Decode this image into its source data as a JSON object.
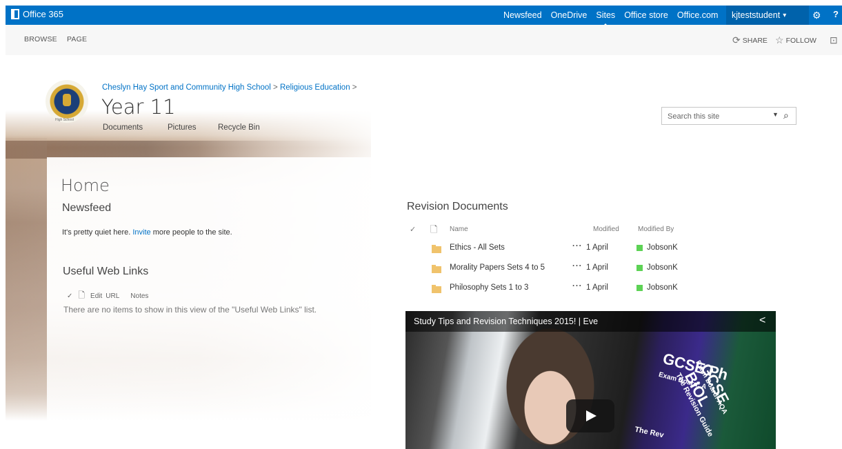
{
  "suite_bar": {
    "brand": "Office 365",
    "nav": [
      "Newsfeed",
      "OneDrive",
      "Sites",
      "Office store",
      "Office.com"
    ],
    "user": "kjteststudent",
    "user_caret": "▾",
    "help_label": "?",
    "accent": "#0072c6"
  },
  "ribbon": {
    "tabs": [
      "BROWSE",
      "PAGE"
    ],
    "share": "SHARE",
    "follow": "FOLLOW"
  },
  "site": {
    "breadcrumb": [
      "Cheslyn Hay Sport and Community High School",
      "Religious Education"
    ],
    "breadcrumb_sep": ">",
    "title": "Year 11",
    "logo_caption": "High School",
    "quick_launch": [
      "Documents",
      "Pictures",
      "Recycle Bin"
    ]
  },
  "search": {
    "placeholder": "Search this site"
  },
  "page": {
    "title": "Home",
    "newsfeed": {
      "title": "Newsfeed",
      "text_before": "It's pretty quiet here. ",
      "link": "Invite",
      "text_after": " more people to the site."
    },
    "useful_links": {
      "title": "Useful Web Links",
      "columns": [
        "Edit",
        "URL",
        "Notes"
      ],
      "empty": "There are no items to show in this view of the \"Useful Web Links\" list."
    }
  },
  "revision_documents": {
    "title": "Revision Documents",
    "columns": {
      "name": "Name",
      "modified": "Modified",
      "modified_by": "Modified By"
    },
    "rows": [
      {
        "name": "Ethics - All Sets",
        "modified": "1 April",
        "modified_by": "JobsonK"
      },
      {
        "name": "Morality Papers Sets 4 to 5",
        "modified": "1 April",
        "modified_by": "JobsonK"
      },
      {
        "name": "Philosophy Sets 1 to 3",
        "modified": "1 April",
        "modified_by": "JobsonK"
      }
    ],
    "presence_color": "#5dd255"
  },
  "video": {
    "title": "Study Tips and Revision Techniques 2015! | Eve",
    "book1": "GCSE Ph",
    "book1_sub": "Exam Board: A",
    "book2": "GCSE BIOL",
    "book2_sub": "Exam Board: AQA",
    "book3": "The Revision Guide",
    "book4": "The Rev"
  }
}
